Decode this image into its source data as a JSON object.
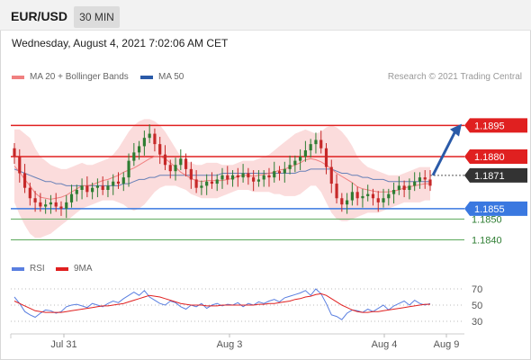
{
  "header": {
    "symbol": "EUR/USD",
    "timeframe": "30 MIN"
  },
  "datetime": "Wednesday, August 4, 2021 7:02:06 AM CET",
  "legend": {
    "bb_label": "MA 20 + Bollinger Bands",
    "bb_color": "#f08080",
    "ma50_label": "MA 50",
    "ma50_color": "#2a5aa8"
  },
  "credit": "Research © 2021 Trading Central",
  "rsi_legend": {
    "rsi_label": "RSI",
    "rsi_color": "#5a7fe0",
    "ma9_label": "9MA",
    "ma9_color": "#e02020"
  },
  "colors": {
    "bull": "#2e7d32",
    "bear": "#c62828",
    "resistance": "#e02020",
    "support": "#3a78e0",
    "target": "#5aa85a",
    "current": "#333333",
    "arrow": "#2a5aa8"
  },
  "chart_data": {
    "type": "candlestick",
    "x_ticks": [
      "Jul 31",
      "Aug 3",
      "Aug 4",
      "Aug 9"
    ],
    "price_ylim": [
      1.1832,
      1.1912
    ],
    "levels": [
      {
        "kind": "resistance",
        "value": 1.1895,
        "label": "1.1895"
      },
      {
        "kind": "resistance",
        "value": 1.188,
        "label": "1.1880"
      },
      {
        "kind": "current",
        "value": 1.1871,
        "label": "1.1871"
      },
      {
        "kind": "support",
        "value": 1.1855,
        "label": "1.1855"
      },
      {
        "kind": "target",
        "value": 1.185,
        "label": "1.1850"
      },
      {
        "kind": "target",
        "value": 1.184,
        "label": "1.1840"
      }
    ],
    "close_series": [
      1.188,
      1.1872,
      1.1865,
      1.186,
      1.1858,
      1.1856,
      1.1857,
      1.1858,
      1.1856,
      1.1855,
      1.1858,
      1.1862,
      1.1864,
      1.1866,
      1.1863,
      1.1865,
      1.1866,
      1.1864,
      1.1866,
      1.1868,
      1.1867,
      1.187,
      1.1878,
      1.1882,
      1.1885,
      1.1889,
      1.1891,
      1.1886,
      1.1881,
      1.1876,
      1.1873,
      1.1876,
      1.1879,
      1.1874,
      1.1869,
      1.1865,
      1.1866,
      1.1868,
      1.1867,
      1.1869,
      1.1871,
      1.1869,
      1.1871,
      1.187,
      1.1872,
      1.187,
      1.1868,
      1.1869,
      1.1871,
      1.187,
      1.1873,
      1.1872,
      1.1874,
      1.1876,
      1.1878,
      1.188,
      1.1883,
      1.1886,
      1.1888,
      1.1884,
      1.1875,
      1.1867,
      1.186,
      1.1857,
      1.1859,
      1.1863,
      1.186,
      1.1861,
      1.1862,
      1.186,
      1.1858,
      1.186,
      1.1862,
      1.1864,
      1.1866,
      1.1864,
      1.1866,
      1.1868,
      1.187,
      1.1869,
      1.1866
    ],
    "bb_upper": [
      1.1893,
      1.1893,
      1.1891,
      1.1889,
      1.1884,
      1.188,
      1.1878,
      1.1876,
      1.1875,
      1.1874,
      1.1874,
      1.1875,
      1.1876,
      1.1877,
      1.1876,
      1.1876,
      1.1877,
      1.1878,
      1.1879,
      1.1881,
      1.1884,
      1.1888,
      1.1892,
      1.1895,
      1.1897,
      1.1898,
      1.1898,
      1.1897,
      1.1895,
      1.1892,
      1.1888,
      1.1884,
      1.188,
      1.1878,
      1.1877,
      1.1876,
      1.1876,
      1.1877,
      1.1877,
      1.1877,
      1.1876,
      1.1876,
      1.1876,
      1.1877,
      1.1878,
      1.1878,
      1.1878,
      1.1879,
      1.188,
      1.1881,
      1.1883,
      1.1885,
      1.1887,
      1.1889,
      1.1891,
      1.1892,
      1.1893,
      1.1892,
      1.1891,
      1.1892,
      1.1894,
      1.1895,
      1.1894,
      1.1892,
      1.1889,
      1.1885,
      1.188,
      1.1877,
      1.1875,
      1.1874,
      1.1873,
      1.1872,
      1.1871,
      1.1871,
      1.1871,
      1.1872,
      1.1873,
      1.1874,
      1.1875,
      1.1875,
      1.1875
    ],
    "bb_lower": [
      1.1858,
      1.1852,
      1.1847,
      1.1843,
      1.1841,
      1.1841,
      1.1842,
      1.1843,
      1.1845,
      1.1847,
      1.1849,
      1.1851,
      1.1853,
      1.1855,
      1.1856,
      1.1857,
      1.1858,
      1.1859,
      1.1859,
      1.1859,
      1.1858,
      1.1857,
      1.1855,
      1.1854,
      1.1855,
      1.1857,
      1.186,
      1.1863,
      1.1865,
      1.1866,
      1.1866,
      1.1866,
      1.1865,
      1.1864,
      1.1862,
      1.1861,
      1.186,
      1.186,
      1.186,
      1.186,
      1.1861,
      1.1862,
      1.1863,
      1.1864,
      1.1864,
      1.1864,
      1.1863,
      1.1863,
      1.1863,
      1.1863,
      1.1862,
      1.1862,
      1.1861,
      1.1861,
      1.1861,
      1.1862,
      1.1864,
      1.1866,
      1.1866,
      1.1863,
      1.1858,
      1.1853,
      1.185,
      1.1849,
      1.1849,
      1.185,
      1.1851,
      1.1852,
      1.1853,
      1.1853,
      1.1853,
      1.1854,
      1.1855,
      1.1856,
      1.1857,
      1.1858,
      1.1858,
      1.1858,
      1.1858,
      1.1859,
      1.1859
    ],
    "ma50": [
      1.1874,
      1.1873,
      1.1872,
      1.1871,
      1.187,
      1.1869,
      1.1868,
      1.1868,
      1.1867,
      1.1867,
      1.1866,
      1.1866,
      1.1866,
      1.1866,
      1.1866,
      1.1866,
      1.1866,
      1.1866,
      1.1866,
      1.1866,
      1.1866,
      1.1867,
      1.1867,
      1.1868,
      1.1869,
      1.1869,
      1.187,
      1.187,
      1.1871,
      1.1871,
      1.1871,
      1.1871,
      1.1871,
      1.1871,
      1.1871,
      1.1871,
      1.1871,
      1.1871,
      1.1871,
      1.1871,
      1.1872,
      1.1872,
      1.1872,
      1.1872,
      1.1872,
      1.1872,
      1.1872,
      1.1872,
      1.1872,
      1.1872,
      1.1872,
      1.1872,
      1.1872,
      1.1872,
      1.1872,
      1.1873,
      1.1873,
      1.1874,
      1.1874,
      1.1874,
      1.1874,
      1.1874,
      1.1873,
      1.1872,
      1.1872,
      1.1871,
      1.1871,
      1.187,
      1.187,
      1.1869,
      1.1869,
      1.1869,
      1.1868,
      1.1868,
      1.1868,
      1.1868,
      1.1868,
      1.1868,
      1.1868,
      1.1868,
      1.1868
    ],
    "forecast_arrow": {
      "from": 1.1871,
      "to": 1.1894
    },
    "rsi": {
      "ylim": [
        20,
        80
      ],
      "ticks": [
        70,
        50,
        30
      ],
      "rsi_series": [
        60,
        52,
        42,
        38,
        35,
        40,
        44,
        43,
        40,
        42,
        48,
        50,
        51,
        49,
        47,
        52,
        50,
        48,
        52,
        55,
        53,
        58,
        62,
        66,
        62,
        68,
        60,
        56,
        52,
        50,
        55,
        53,
        48,
        45,
        50,
        48,
        52,
        46,
        50,
        52,
        49,
        51,
        50,
        53,
        48,
        52,
        50,
        54,
        52,
        55,
        57,
        54,
        59,
        61,
        63,
        65,
        68,
        62,
        70,
        64,
        52,
        38,
        36,
        32,
        40,
        44,
        43,
        41,
        45,
        42,
        46,
        50,
        44,
        49,
        52,
        55,
        50,
        56,
        52,
        50,
        52
      ],
      "ma9_series": [
        55,
        52,
        49,
        46,
        43,
        42,
        41,
        41,
        41,
        41,
        42,
        43,
        44,
        45,
        46,
        47,
        48,
        49,
        49,
        50,
        51,
        52,
        54,
        56,
        58,
        60,
        62,
        61,
        60,
        58,
        56,
        54,
        52,
        51,
        50,
        50,
        50,
        49,
        49,
        49,
        50,
        50,
        50,
        50,
        50,
        50,
        50,
        51,
        51,
        52,
        52,
        53,
        54,
        55,
        57,
        58,
        60,
        61,
        63,
        64,
        62,
        58,
        54,
        50,
        47,
        44,
        42,
        41,
        41,
        42,
        42,
        43,
        44,
        45,
        46,
        47,
        48,
        49,
        50,
        51,
        51
      ]
    }
  }
}
